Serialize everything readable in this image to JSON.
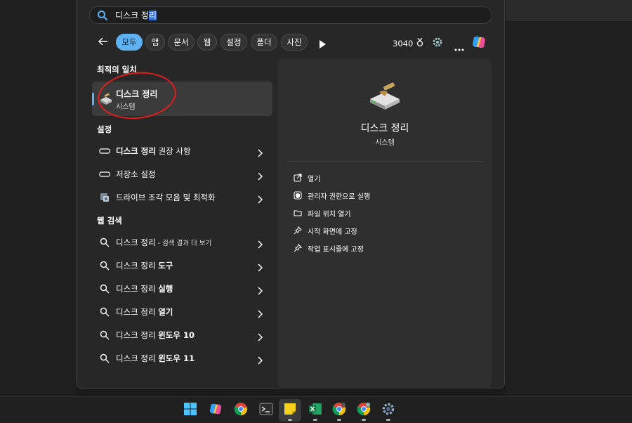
{
  "search": {
    "query_prefix": "디스크 정",
    "query_selected": "리"
  },
  "filters": {
    "chips": [
      {
        "label": "모두",
        "active": true
      },
      {
        "label": "앱"
      },
      {
        "label": "문서"
      },
      {
        "label": "웹"
      },
      {
        "label": "설정"
      },
      {
        "label": "폴더"
      },
      {
        "label": "사진"
      }
    ],
    "points": "3040"
  },
  "sections": {
    "best_match": "최적의 일치",
    "settings": "설정",
    "web_search": "웹 검색"
  },
  "best_match": {
    "title": "디스크 정리",
    "subtitle": "시스템"
  },
  "settings_items": [
    {
      "bold": "디스크 정리",
      "rest": " 권장 사항"
    },
    {
      "bold": "",
      "rest": "저장소 설정"
    },
    {
      "bold": "",
      "rest": "드라이브 조각 모음 및 최적화"
    }
  ],
  "web_items": [
    {
      "normal": "디스크 정리",
      "small": " - 검색 결과 더 보기",
      "bold": ""
    },
    {
      "normal": "디스크 정리 ",
      "small": "",
      "bold": "도구"
    },
    {
      "normal": "디스크 정리 ",
      "small": "",
      "bold": "실행"
    },
    {
      "normal": "디스크 정리 ",
      "small": "",
      "bold": "열기"
    },
    {
      "normal": "디스크 정리 ",
      "small": "",
      "bold": "윈도우 10"
    },
    {
      "normal": "디스크 정리 ",
      "small": "",
      "bold": "윈도우 11"
    }
  ],
  "preview": {
    "title": "디스크 정리",
    "subtitle": "시스템",
    "actions": [
      {
        "label": "열기",
        "icon": "open-icon"
      },
      {
        "label": "관리자 권한으로 실행",
        "icon": "admin-shield-icon"
      },
      {
        "label": "파일 위치 열기",
        "icon": "folder-icon"
      },
      {
        "label": "시작 화면에 고정",
        "icon": "pin-icon"
      },
      {
        "label": "작업 표시줄에 고정",
        "icon": "pin-icon"
      }
    ]
  },
  "taskbar": {
    "apps": [
      "start-icon",
      "copilot-icon",
      "chrome-icon",
      "terminal-icon",
      "sticky-notes-icon",
      "excel-icon",
      "chrome-profile-icon",
      "chrome-profile-2-icon",
      "settings-icon"
    ]
  },
  "colors": {
    "accent": "#5fb2f2",
    "annotation": "#e21d1d",
    "panel": "#272727"
  }
}
